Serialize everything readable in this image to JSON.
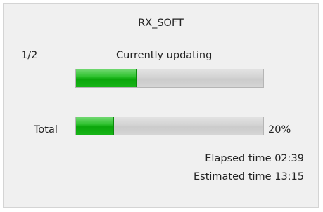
{
  "window": {
    "title": "RX_SOFT"
  },
  "current": {
    "counter": "1/2",
    "status": "Currently updating",
    "progress_fraction": 0.32
  },
  "total": {
    "label": "Total",
    "percent_text": "20%",
    "progress_fraction": 0.2
  },
  "times": {
    "elapsed": "Elapsed time 02:39",
    "estimated": "Estimated time 13:15"
  },
  "colors": {
    "progress_fill": "#1fb51f",
    "track": "#d3d3d3",
    "panel_background": "#f0f0f0"
  }
}
